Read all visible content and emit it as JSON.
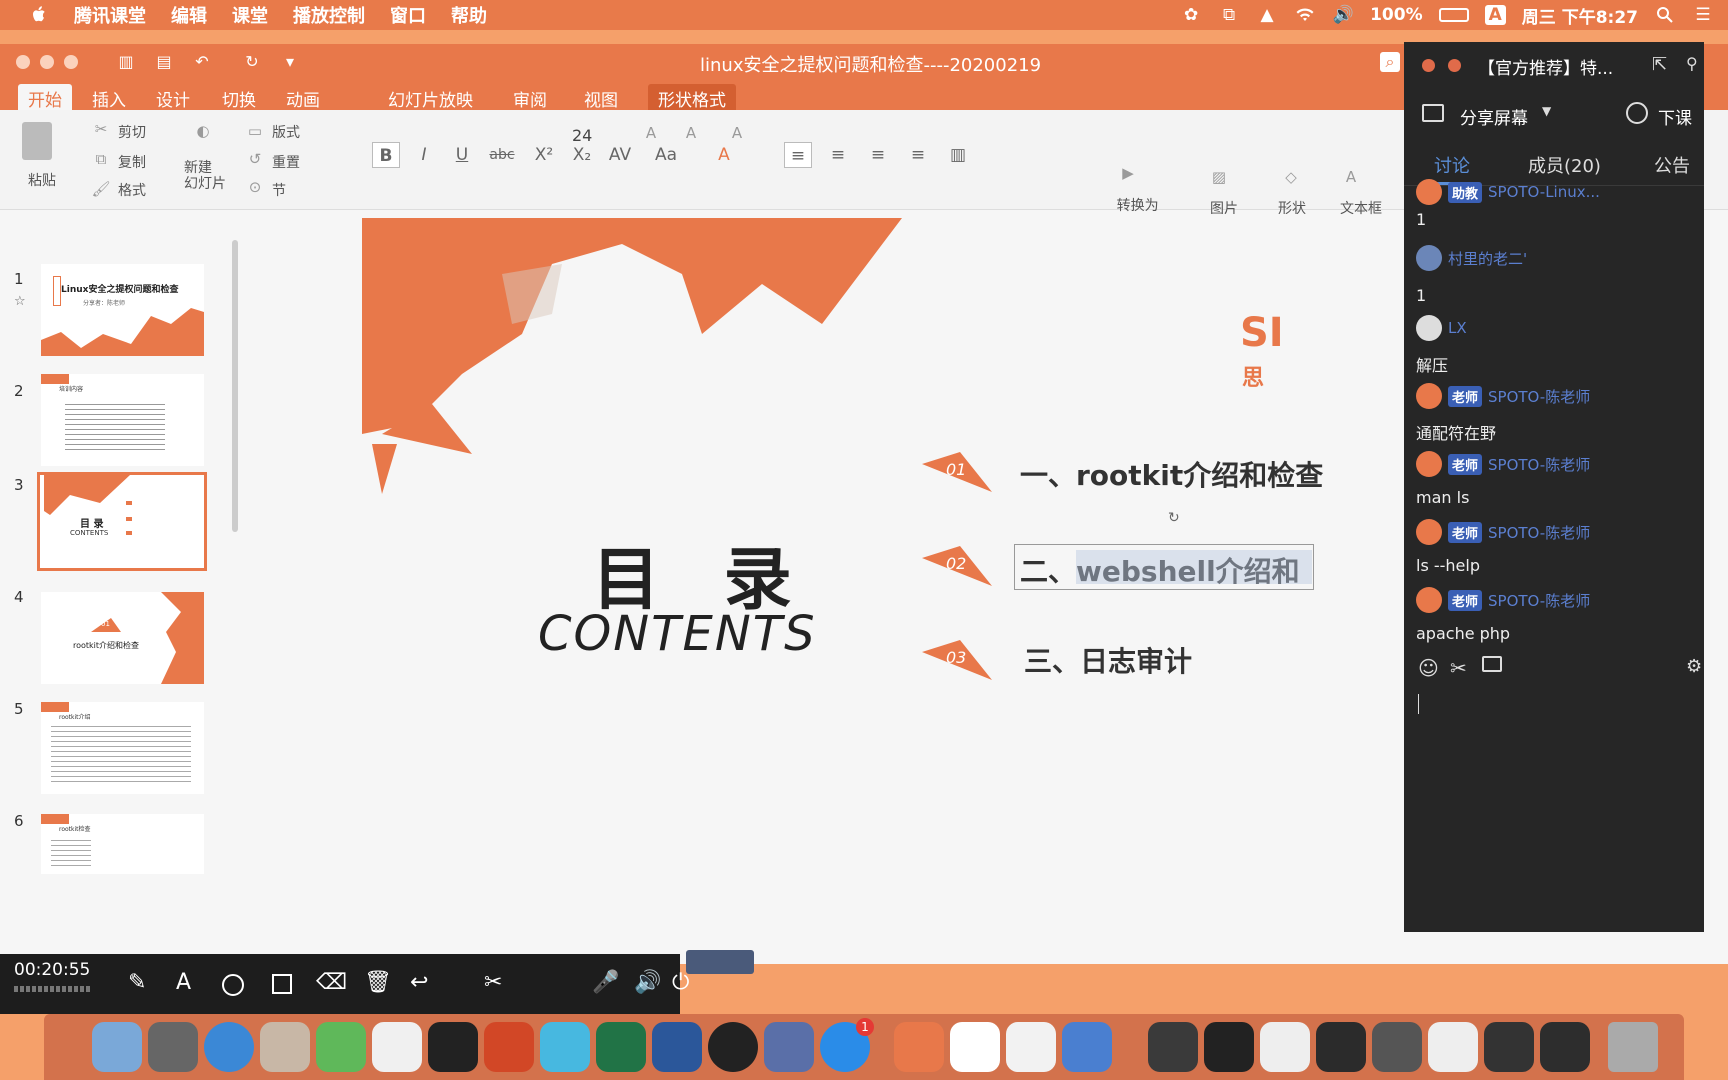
{
  "menubar": {
    "app": "腾讯课堂",
    "items": [
      "编辑",
      "课堂",
      "播放控制",
      "窗口",
      "帮助"
    ],
    "battery": "100%",
    "input_method": "A",
    "clock": "周三 下午8:27"
  },
  "window": {
    "title": "linux安全之提权问题和检查----20200219"
  },
  "ribbon": {
    "tabs": [
      "开始",
      "插入",
      "设计",
      "切换",
      "动画",
      "幻灯片放映",
      "审阅",
      "视图",
      "形状格式"
    ],
    "paste": "粘贴",
    "cut": "剪切",
    "copy": "复制",
    "format": "格式",
    "new_slide": "新建\n幻灯片",
    "layout": "版式",
    "reset": "重置",
    "section": "节",
    "font_size": "24",
    "smartart": "转换为\nSmartArt",
    "picture": "图片",
    "shapes": "形状",
    "textbox": "文本框"
  },
  "thumbnails": [
    {
      "num": "1",
      "title": "Linux安全之提权问题和检查",
      "subtitle": "分享者：陈老师"
    },
    {
      "num": "2",
      "title": "培训内容"
    },
    {
      "num": "3",
      "title": "目 录",
      "subtitle": "CONTENTS"
    },
    {
      "num": "4",
      "title": "rootkit介绍和检查",
      "badge": "01"
    },
    {
      "num": "5",
      "title": "rootkit介绍"
    },
    {
      "num": "6",
      "title": "rootkit检查"
    }
  ],
  "slide": {
    "title": "目 录",
    "subtitle": "CONTENTS",
    "items": [
      {
        "num": "01",
        "text": "一、rootkit介绍和检查"
      },
      {
        "num": "02",
        "text": "二、webshell介绍和"
      },
      {
        "num": "03",
        "text": "三、日志审计"
      }
    ],
    "logo_partial": "SI",
    "logo_partial2": "思"
  },
  "chat": {
    "title": "【官方推荐】特...",
    "share_screen": "分享屏幕",
    "end_class": "下课",
    "tabs": [
      "讨论",
      "成员(20)",
      "公告"
    ],
    "messages": [
      {
        "badge": "助教",
        "nick": "SPOTO-Linux...",
        "text": "1"
      },
      {
        "badge": "",
        "nick": "村里的老二'",
        "text": "1"
      },
      {
        "badge": "",
        "nick": "LX",
        "text": "解压"
      },
      {
        "badge": "老师",
        "nick": "SPOTO-陈老师",
        "text": "通配符在野"
      },
      {
        "badge": "老师",
        "nick": "SPOTO-陈老师",
        "text": "man  ls"
      },
      {
        "badge": "老师",
        "nick": "SPOTO-陈老师",
        "text": "ls   --help"
      },
      {
        "badge": "老师",
        "nick": "SPOTO-陈老师",
        "text": "apache    php"
      }
    ]
  },
  "recorder": {
    "time": "00:20:55"
  },
  "dock": {
    "badge_count": "1"
  }
}
